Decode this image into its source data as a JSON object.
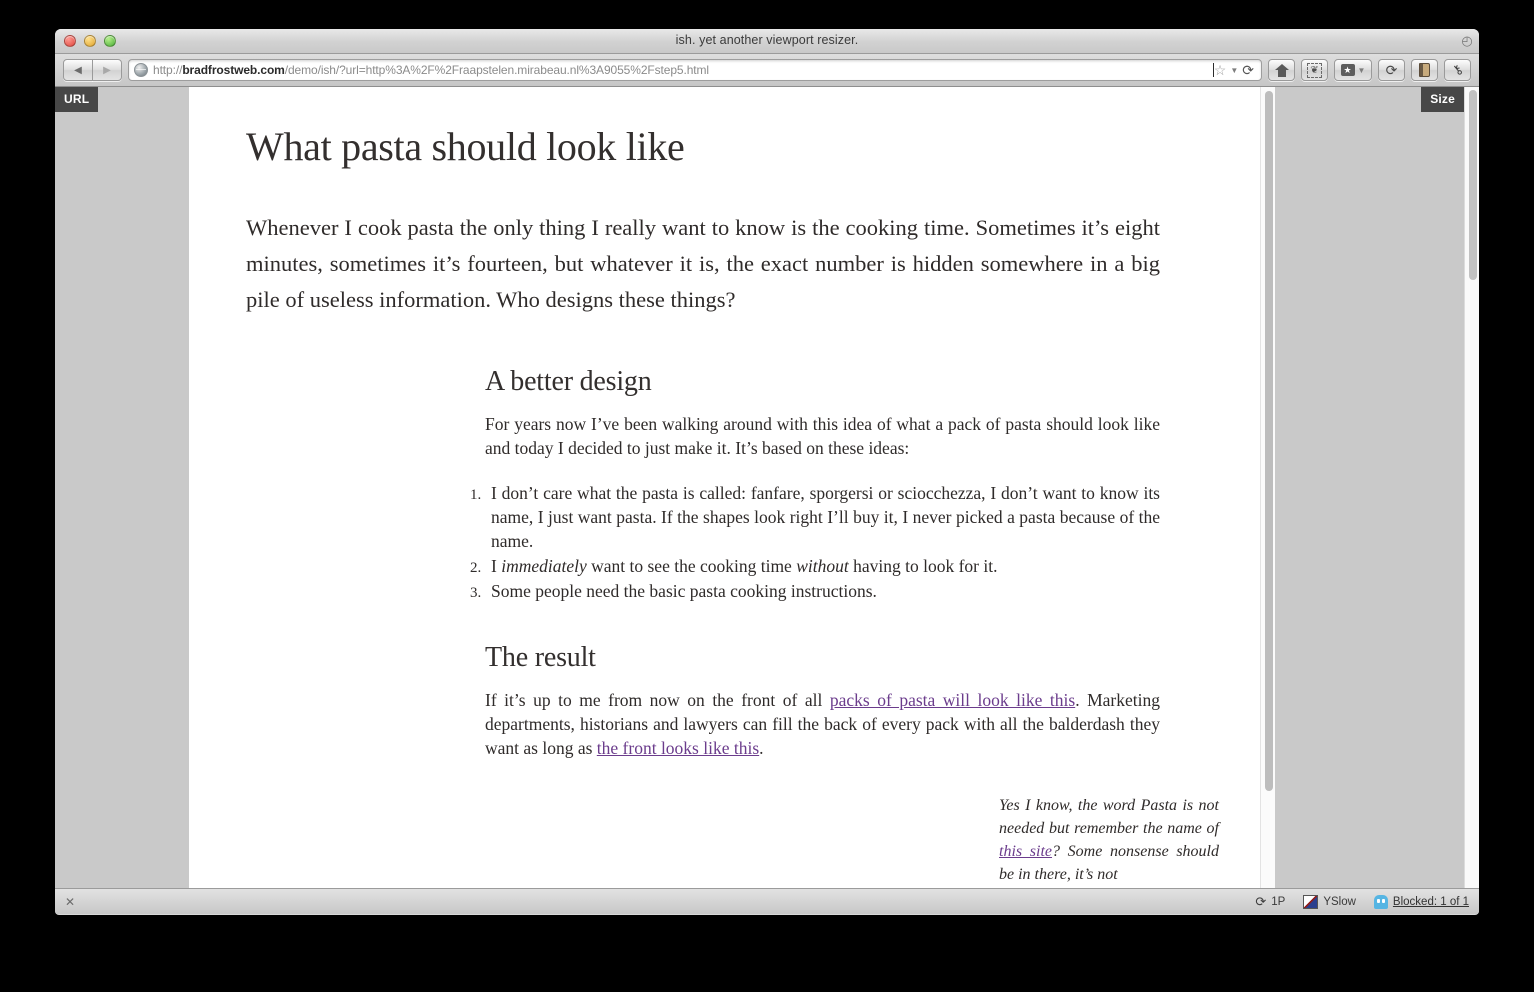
{
  "window": {
    "title": "ish. yet another viewport resizer.",
    "traffic_lights": [
      "close",
      "minimize",
      "zoom"
    ]
  },
  "toolbar": {
    "back_label": "◀",
    "forward_label": "▶",
    "url_host": "bradfrostweb.com",
    "url_prefix": "http://",
    "url_suffix": "/demo/ish/?url=http%3A%2F%2Fraapstelen.mirabeau.nl%3A9055%2Fstep5.html",
    "bookmark_star": "☆",
    "bookmark_caret": "▼",
    "reload_glyph": "⟳",
    "buttons": [
      {
        "name": "home",
        "glyph": ""
      },
      {
        "name": "evernote-clipper",
        "glyph": "❦"
      },
      {
        "name": "bookmarks-menu",
        "glyph": "★"
      },
      {
        "name": "sync",
        "glyph": "⟳"
      },
      {
        "name": "reading-list",
        "glyph": ""
      },
      {
        "name": "password-manager",
        "glyph": "⚷"
      }
    ]
  },
  "ish": {
    "url_badge": "URL",
    "size_badge": "Size"
  },
  "document": {
    "title": "What pasta should look like",
    "intro": "Whenever I cook pasta the only thing I really want to know is the cooking time. Sometimes it’s eight minutes, sometimes it’s fourteen, but whatever it is, the exact number is hidden somewhere in a big pile of useless information. Who designs these things?",
    "section_better": {
      "heading": "A better design",
      "paragraph": "For years now I’ve been walking around with this idea of what a pack of pasta should look like and today I decided to just make it. It’s based on these ideas:",
      "items": [
        {
          "parts": [
            {
              "text": "I don’t care what the pasta is called: fanfare, sporgersi or sciocchezza, I don’t want to know its name, I just want pasta. If the shapes look right I’ll buy it, I never picked a pasta because of the name.",
              "style": "normal"
            }
          ]
        },
        {
          "parts": [
            {
              "text": "I ",
              "style": "normal"
            },
            {
              "text": "immediately",
              "style": "italic"
            },
            {
              "text": " want to see the cooking time ",
              "style": "normal"
            },
            {
              "text": "without",
              "style": "italic"
            },
            {
              "text": " having to look for it.",
              "style": "normal"
            }
          ]
        },
        {
          "parts": [
            {
              "text": "Some people need the basic pasta cooking instructions.",
              "style": "normal"
            }
          ]
        }
      ]
    },
    "section_result": {
      "heading": "The result",
      "parts": [
        {
          "text": "If it’s up to me from now on the front of all ",
          "style": "normal"
        },
        {
          "text": "packs of pasta will look like this",
          "style": "link"
        },
        {
          "text": ". Marketing departments, historians and lawyers can fill the back of every pack with all the balderdash they want as long as ",
          "style": "normal"
        },
        {
          "text": "the front looks like this",
          "style": "link"
        },
        {
          "text": ".",
          "style": "normal"
        }
      ]
    },
    "aside": {
      "parts": [
        {
          "text": "Yes I know, the word Pasta is not needed but remember the name of ",
          "style": "normal"
        },
        {
          "text": "this site",
          "style": "link"
        },
        {
          "text": "? Some nonsense should be in there, it’s not",
          "style": "normal"
        }
      ]
    },
    "link_color": "#6b3c8c"
  },
  "statusbar": {
    "close_glyph": "✕",
    "onepassword_label": "1P",
    "yslow_label": "YSlow",
    "blocked_label": "Blocked: 1 of 1"
  }
}
